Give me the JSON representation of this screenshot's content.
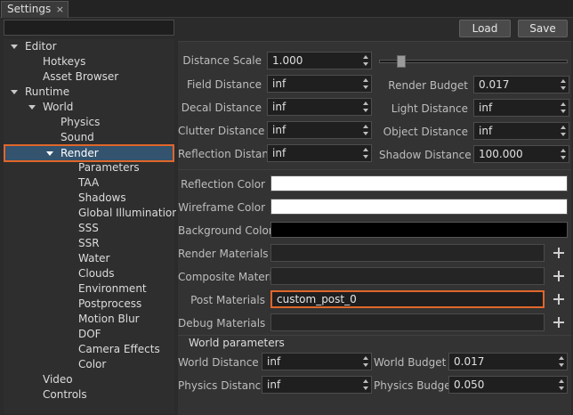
{
  "tab": {
    "label": "Settings",
    "close": "×"
  },
  "tree": [
    {
      "label": "Editor"
    },
    {
      "label": "Hotkeys"
    },
    {
      "label": "Asset Browser"
    },
    {
      "label": "Runtime"
    },
    {
      "label": "World"
    },
    {
      "label": "Physics"
    },
    {
      "label": "Sound"
    },
    {
      "label": "Render"
    },
    {
      "label": "Parameters"
    },
    {
      "label": "TAA"
    },
    {
      "label": "Shadows"
    },
    {
      "label": "Global Illumination"
    },
    {
      "label": "SSS"
    },
    {
      "label": "SSR"
    },
    {
      "label": "Water"
    },
    {
      "label": "Clouds"
    },
    {
      "label": "Environment"
    },
    {
      "label": "Postprocess"
    },
    {
      "label": "Motion Blur"
    },
    {
      "label": "DOF"
    },
    {
      "label": "Camera Effects"
    },
    {
      "label": "Color"
    },
    {
      "label": "Video"
    },
    {
      "label": "Controls"
    }
  ],
  "toolbar": {
    "load": "Load",
    "save": "Save"
  },
  "fields": {
    "distance_scale": {
      "label": "Distance Scale",
      "value": "1.000"
    },
    "distance_scale_slider": 0.1,
    "field_distance": {
      "label": "Field Distance",
      "value": "inf"
    },
    "decal_distance": {
      "label": "Decal Distance",
      "value": "inf"
    },
    "clutter_distance": {
      "label": "Clutter Distance",
      "value": "inf"
    },
    "reflection_distance": {
      "label": "Reflection Distance",
      "value": "inf"
    },
    "render_budget": {
      "label": "Render Budget",
      "value": "0.017"
    },
    "light_distance": {
      "label": "Light Distance",
      "value": "inf"
    },
    "object_distance": {
      "label": "Object Distance",
      "value": "inf"
    },
    "shadow_distance": {
      "label": "Shadow Distance",
      "value": "100.000"
    }
  },
  "colors": {
    "reflection": {
      "label": "Reflection Color",
      "value": "#ffffff"
    },
    "wireframe": {
      "label": "Wireframe Color",
      "value": "#ffffff"
    },
    "background": {
      "label": "Background Color",
      "value": "#000000"
    }
  },
  "materials": {
    "render": {
      "label": "Render Materials",
      "value": ""
    },
    "composite": {
      "label": "Composite Materials",
      "value": ""
    },
    "post": {
      "label": "Post Materials",
      "value": "custom_post_0"
    },
    "debug": {
      "label": "Debug Materials",
      "value": ""
    }
  },
  "world": {
    "title": "World parameters",
    "world_distance": {
      "label": "World Distance",
      "value": "inf"
    },
    "physics_distance": {
      "label": "Physics Distance",
      "value": "inf"
    },
    "world_budget": {
      "label": "World Budget",
      "value": "0.017"
    },
    "physics_budget": {
      "label": "Physics Budget",
      "value": "0.050"
    }
  }
}
